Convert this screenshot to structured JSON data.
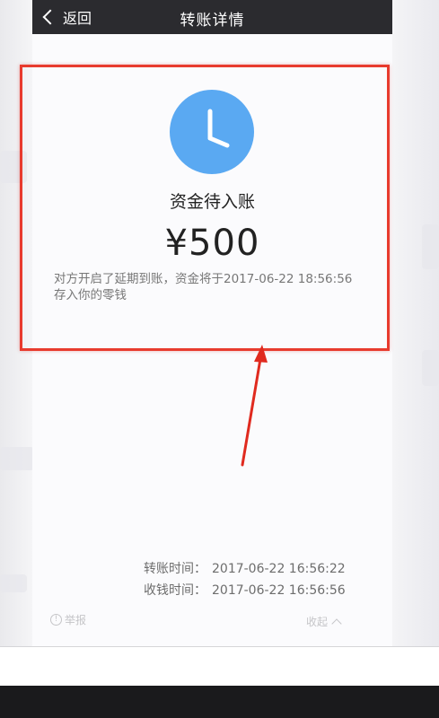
{
  "nav": {
    "back_label": "返回",
    "title": "转账详情"
  },
  "transfer": {
    "status": "资金待入账",
    "amount": "¥500",
    "notice_line1": "对方开启了延期到账，资金将于2017-06-22 18:56:56",
    "notice_line2": "存入你的零钱"
  },
  "times": {
    "transfer_label": "转账时间：",
    "transfer_value": "2017-06-22 16:56:22",
    "receive_label": "收钱时间：",
    "receive_value": "2017-06-22 16:56:56"
  },
  "bottom": {
    "report_label": "举报",
    "collapse_label": "收起"
  },
  "colors": {
    "clock_icon": "#5aa9f2",
    "highlight_frame": "#e83b2e",
    "nav_bar": "#2b2b2f"
  },
  "icons": {
    "status": "clock-icon",
    "back": "chevron-left-icon",
    "annotation": "red-arrow-icon"
  }
}
